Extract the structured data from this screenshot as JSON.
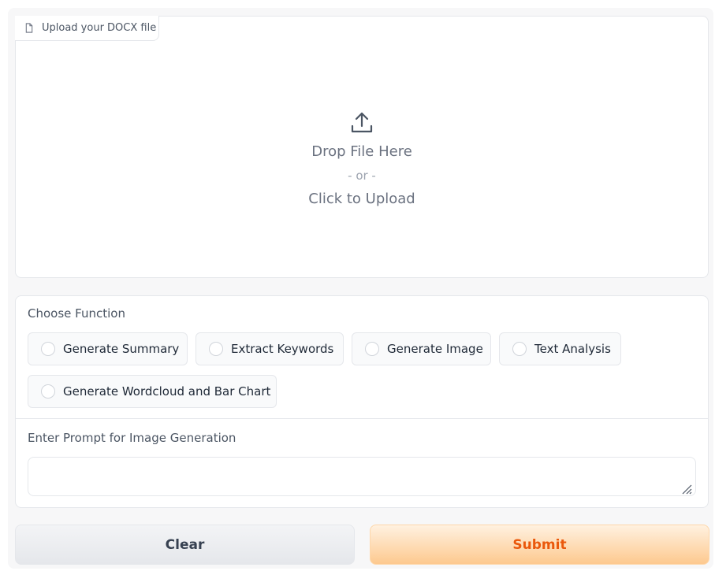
{
  "upload": {
    "label": "Upload your DOCX file",
    "drop_text": "Drop File Here",
    "or_text": "- or -",
    "click_text": "Click to Upload"
  },
  "function": {
    "title": "Choose Function",
    "options": [
      "Generate Summary",
      "Extract Keywords",
      "Generate Image",
      "Text Analysis",
      "Generate Wordcloud and Bar Chart"
    ]
  },
  "prompt": {
    "label": "Enter Prompt for Image Generation",
    "value": ""
  },
  "actions": {
    "clear_label": "Clear",
    "submit_label": "Submit"
  },
  "icons": {
    "file": "file-icon",
    "upload": "upload-icon",
    "resize": "resize-handle-icon"
  },
  "colors": {
    "submit_text": "#ea580c",
    "submit_bg": "#fdc98f",
    "border": "#e5e7eb"
  }
}
